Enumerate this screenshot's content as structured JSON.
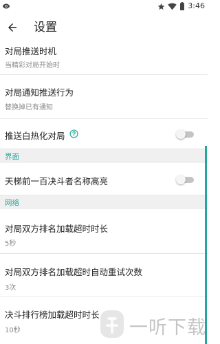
{
  "status_bar": {
    "time": "3:46"
  },
  "app_bar": {
    "title": "设置"
  },
  "settings": {
    "push_time": {
      "title": "对局推送时机",
      "value": "当精彩对局开始时"
    },
    "push_behavior": {
      "title": "对局通知推送行为",
      "value": "替换掉已有通知"
    },
    "push_heated": {
      "title": "推送白热化对局",
      "enabled": false
    },
    "section_interface": "界面",
    "ladder_highlight": {
      "title": "天梯前一百决斗者名称高亮",
      "enabled": false
    },
    "section_network": "网络",
    "rank_timeout": {
      "title": "对局双方排名加载超时时长",
      "value": "5秒"
    },
    "rank_retry": {
      "title": "对局双方排名加载超时自动重试次数",
      "value": "3次"
    },
    "leaderboard_timeout": {
      "title": "决斗排行榜加载超时时长",
      "value": "10秒"
    }
  },
  "watermark": {
    "text": "一听下载"
  },
  "colors": {
    "accent": "#26a69a",
    "section_bg": "#f0f0f0"
  }
}
